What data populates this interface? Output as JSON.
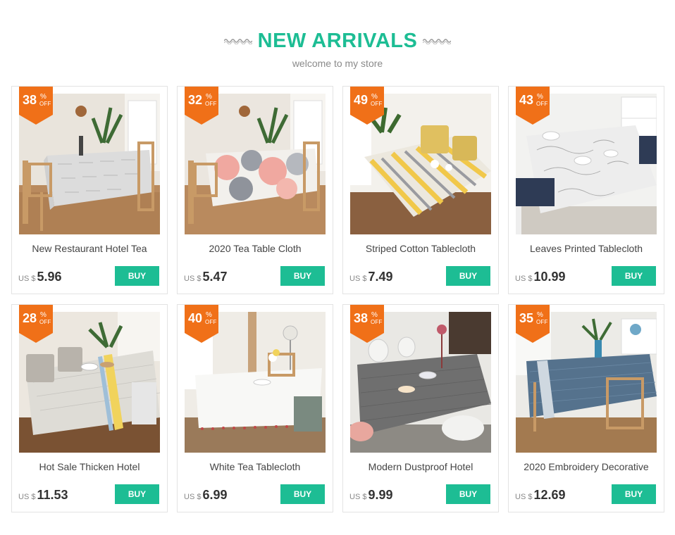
{
  "header": {
    "title": "NEW ARRIVALS",
    "subtitle": "welcome to my store"
  },
  "colors": {
    "accent": "#1dbd94",
    "badge": "#f07018",
    "subtitle": "#8a8a8a"
  },
  "products": [
    {
      "discount": "38",
      "name": "New Restaurant Hotel Tea",
      "currency": "US $",
      "price": "5.96",
      "buy_label": "BUY",
      "image": "gray-patterned-tablecloth-dining-room"
    },
    {
      "discount": "32",
      "name": "2020 Tea Table Cloth",
      "currency": "US $",
      "price": "5.47",
      "buy_label": "BUY",
      "image": "pink-gray-circles-tablecloth-dining-room"
    },
    {
      "discount": "49",
      "name": "Striped Cotton Tablecloth",
      "currency": "US $",
      "price": "7.49",
      "buy_label": "BUY",
      "image": "yellow-gray-striped-tablecloth"
    },
    {
      "discount": "43",
      "name": "Leaves Printed Tablecloth",
      "currency": "US $",
      "price": "10.99",
      "buy_label": "BUY",
      "image": "white-leaf-print-tablecloth"
    },
    {
      "discount": "28",
      "name": "Hot Sale Thicken Hotel",
      "currency": "US $",
      "price": "11.53",
      "buy_label": "BUY",
      "image": "gray-tassel-tablecloth-yellow-stripe"
    },
    {
      "discount": "40",
      "name": "White Tea Tablecloth",
      "currency": "US $",
      "price": "6.99",
      "buy_label": "BUY",
      "image": "white-pompom-tablecloth"
    },
    {
      "discount": "38",
      "name": "Modern Dustproof Hotel",
      "currency": "US $",
      "price": "9.99",
      "buy_label": "BUY",
      "image": "dark-gray-tablecloth-white-chairs"
    },
    {
      "discount": "35",
      "name": "2020 Embroidery Decorative",
      "currency": "US $",
      "price": "12.69",
      "buy_label": "BUY",
      "image": "blue-embroidered-tablecloth"
    }
  ],
  "badge_labels": {
    "percent": "%",
    "off": "OFF"
  }
}
